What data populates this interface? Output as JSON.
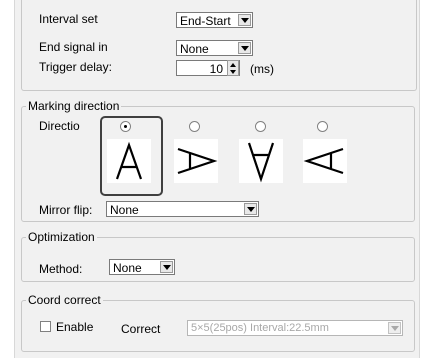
{
  "interval_set": {
    "label": "Interval set",
    "value": "End-Start"
  },
  "end_signal": {
    "label": "End signal in",
    "value": "None"
  },
  "trigger_delay": {
    "label": "Trigger delay:",
    "value": "10",
    "unit": "(ms)"
  },
  "marking_direction": {
    "title": "Marking direction",
    "label": "Directio",
    "options": [
      {
        "glyph": "A",
        "selected": true
      },
      {
        "glyph": "A rotated right",
        "selected": false
      },
      {
        "glyph": "A upside-down",
        "selected": false
      },
      {
        "glyph": "A rotated left",
        "selected": false
      }
    ]
  },
  "mirror_flip": {
    "label": "Mirror flip:",
    "value": "None"
  },
  "optimization": {
    "title": "Optimization",
    "method_label": "Method:",
    "method_value": "None"
  },
  "coord_correct": {
    "title": "Coord correct",
    "enable_label": "Enable",
    "correct_label": "Correct",
    "correct_value": "5×5(25pos) Interval:22.5mm",
    "enabled": false
  }
}
